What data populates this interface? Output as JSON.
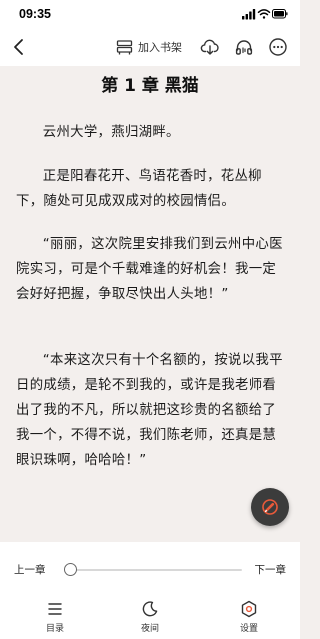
{
  "status_bar": {
    "time": "09:35"
  },
  "top_nav": {
    "add_shelf_label": "加入书架"
  },
  "reader": {
    "chapter_title": "第 1 章 黑猫",
    "paragraphs": [
      "云州大学，燕归湖畔。",
      "正是阳春花开、鸟语花香时，花丛柳下，随处可见成双成对的校园情侣。",
      "“丽丽，这次院里安排我们到云州中心医院实习，可是个千载难逢的好机会！我一定会好好把握，争取尽快出人头地！”",
      "“本来这次只有十个名额的，按说以我平日的成绩，是轮不到我的，或许是我老师看出了我的不凡，所以就把这珍贵的名额给了我一个，不得不说，我们陈老师，还真是慧眼识珠啊，哈哈哈！”"
    ]
  },
  "progress": {
    "prev_label": "上一章",
    "next_label": "下一章",
    "value": 0
  },
  "tabs": [
    {
      "label": "目录",
      "icon": "menu-list-icon"
    },
    {
      "label": "夜间",
      "icon": "moon-icon"
    },
    {
      "label": "设置",
      "icon": "settings-gear-icon"
    }
  ]
}
